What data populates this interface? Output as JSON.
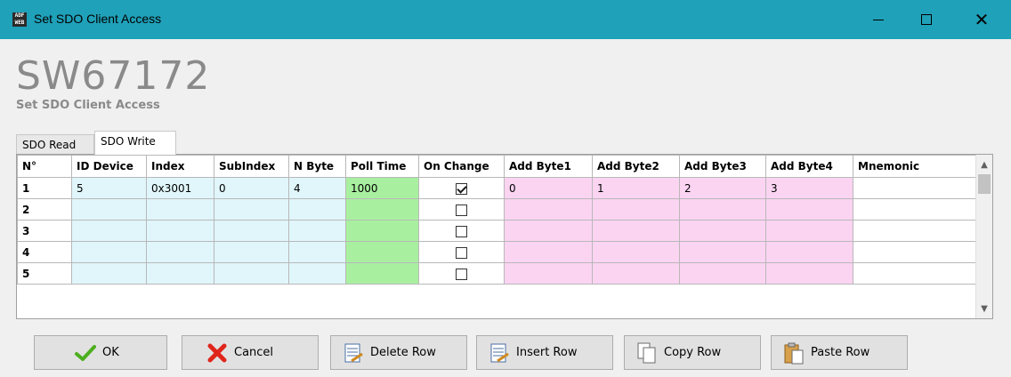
{
  "window": {
    "title": "Set SDO Client Access",
    "icon_text_top": "ADF",
    "icon_text_bottom": "WEB"
  },
  "header": {
    "product": "SW67172",
    "subtitle": "Set SDO Client Access"
  },
  "tabs": [
    {
      "label": "SDO Read",
      "active": false
    },
    {
      "label": "SDO Write",
      "active": true
    }
  ],
  "grid": {
    "columns": [
      "N°",
      "ID Device",
      "Index",
      "SubIndex",
      "N Byte",
      "Poll Time",
      "On Change",
      "Add Byte1",
      "Add Byte2",
      "Add Byte3",
      "Add Byte4",
      "Mnemonic"
    ],
    "rows": [
      {
        "n": "1",
        "id_device": "5",
        "index": "0x3001",
        "subindex": "0",
        "n_byte": "4",
        "poll_time": "1000",
        "on_change": true,
        "add_byte1": "0",
        "add_byte2": "1",
        "add_byte3": "2",
        "add_byte4": "3",
        "mnemonic": ""
      },
      {
        "n": "2",
        "id_device": "",
        "index": "",
        "subindex": "",
        "n_byte": "",
        "poll_time": "",
        "on_change": false,
        "add_byte1": "",
        "add_byte2": "",
        "add_byte3": "",
        "add_byte4": "",
        "mnemonic": ""
      },
      {
        "n": "3",
        "id_device": "",
        "index": "",
        "subindex": "",
        "n_byte": "",
        "poll_time": "",
        "on_change": false,
        "add_byte1": "",
        "add_byte2": "",
        "add_byte3": "",
        "add_byte4": "",
        "mnemonic": ""
      },
      {
        "n": "4",
        "id_device": "",
        "index": "",
        "subindex": "",
        "n_byte": "",
        "poll_time": "",
        "on_change": false,
        "add_byte1": "",
        "add_byte2": "",
        "add_byte3": "",
        "add_byte4": "",
        "mnemonic": ""
      },
      {
        "n": "5",
        "id_device": "",
        "index": "",
        "subindex": "",
        "n_byte": "",
        "poll_time": "",
        "on_change": false,
        "add_byte1": "",
        "add_byte2": "",
        "add_byte3": "",
        "add_byte4": "",
        "mnemonic": ""
      }
    ]
  },
  "buttons": {
    "ok": "OK",
    "cancel": "Cancel",
    "delete_row": "Delete Row",
    "insert_row": "Insert Row",
    "copy_row": "Copy Row",
    "paste_row": "Paste Row"
  },
  "colors": {
    "titlebar": "#1fa1b9",
    "cell_blue": "#e0f6fb",
    "cell_green": "#a8f0a0",
    "cell_pink": "#fbd4f2"
  }
}
